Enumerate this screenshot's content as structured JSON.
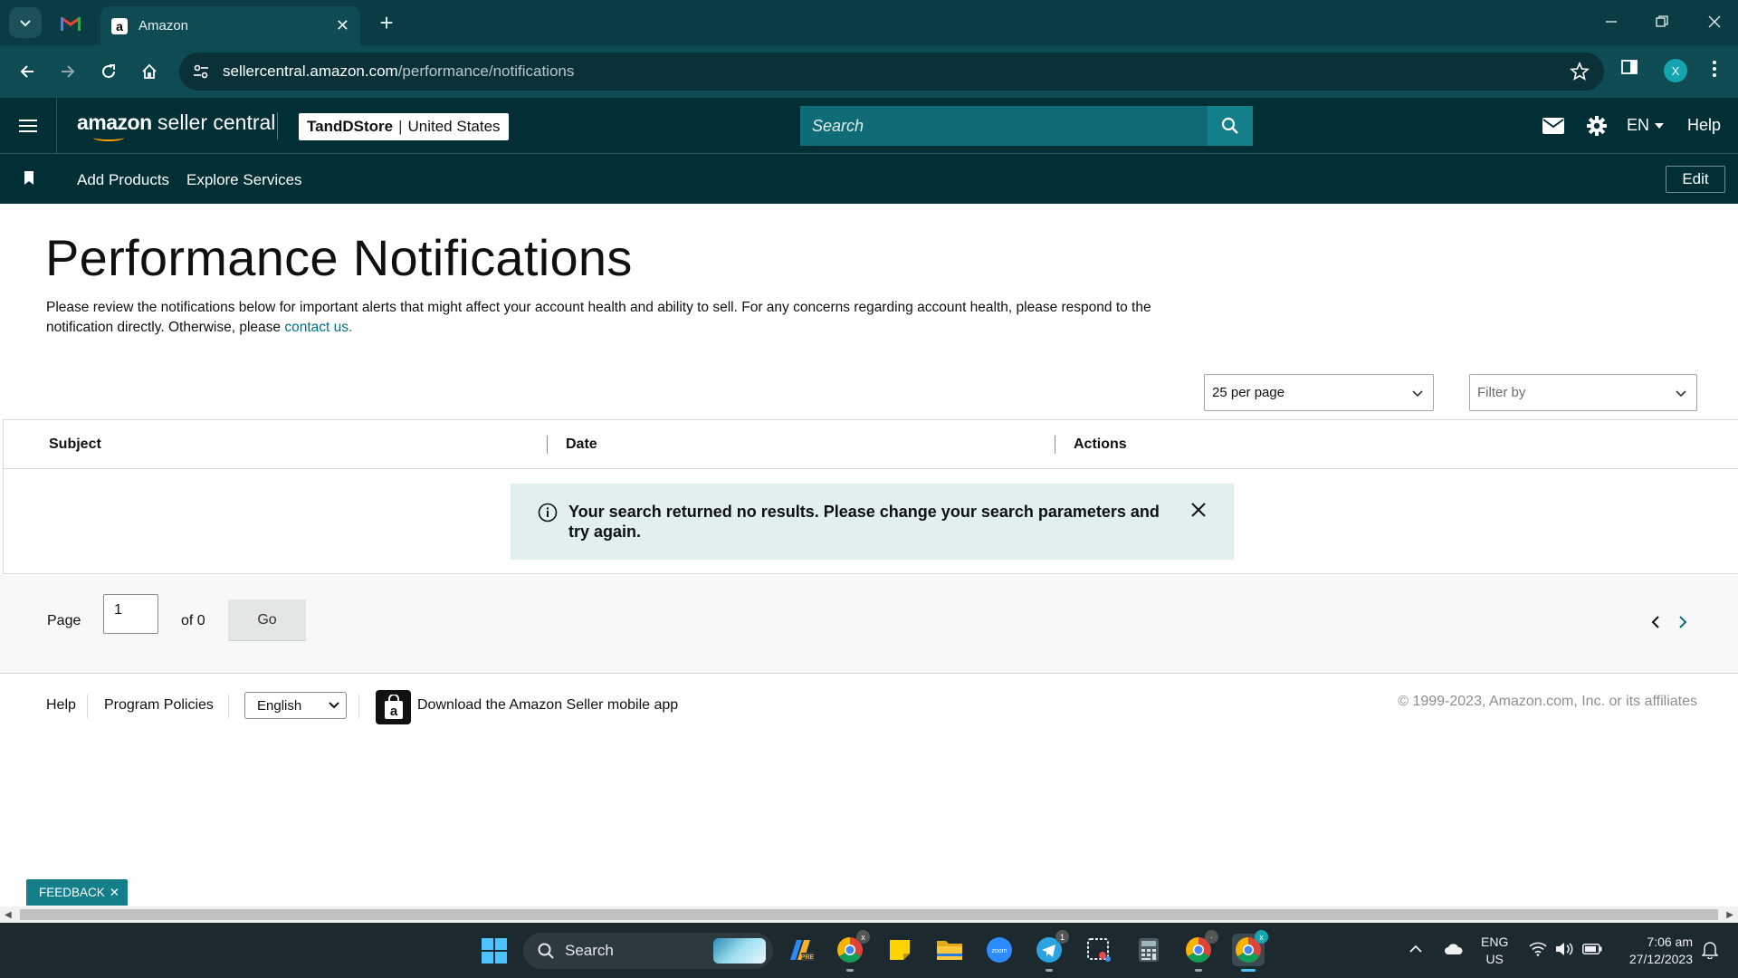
{
  "browser": {
    "tab_title": "Amazon",
    "url_host": "sellercentral.amazon.com",
    "url_path": "/performance/notifications",
    "profile_initial": "X"
  },
  "header": {
    "logo_bold": "amazon",
    "logo_rest": " seller central",
    "store_name": "TandDStore",
    "store_separator": "|",
    "store_region": "United States",
    "search_placeholder": "Search",
    "language": "EN",
    "help": "Help"
  },
  "subnav": {
    "links": [
      "Add Products",
      "Explore Services"
    ],
    "edit_label": "Edit"
  },
  "page": {
    "title": "Performance Notifications",
    "intro_text": "Please review the notifications below for important alerts that might affect your account health and ability to sell. For any concerns regarding account health, please respond to the notification directly. Otherwise, please ",
    "intro_link": "contact us."
  },
  "controls": {
    "per_page": "25 per page",
    "filter_placeholder": "Filter by"
  },
  "table": {
    "columns": [
      "Subject",
      "Date",
      "Actions"
    ],
    "empty_message": "Your search returned no results. Please change your search parameters and try again."
  },
  "pager": {
    "page_label": "Page",
    "page_value": "1",
    "of_label": "of 0",
    "go_label": "Go"
  },
  "footer": {
    "help": "Help",
    "program_policies": "Program Policies",
    "language_select": "English",
    "app_link": "Download the Amazon Seller mobile app",
    "copyright": "© 1999-2023, Amazon.com, Inc. or its affiliates"
  },
  "feedback": {
    "label": "FEEDBACK"
  },
  "taskbar": {
    "search_label": "Search",
    "lang_line1": "ENG",
    "lang_line2": "US",
    "time": "7:06 am",
    "date": "27/12/2023",
    "telegram_badge": "1"
  },
  "colors": {
    "chrome_tabbar": "#0c3c43",
    "chrome_toolbar": "#0e4b52",
    "seller_header": "#002f36",
    "search_teal": "#127f8a",
    "link": "#007185",
    "alert_bg": "#e1eff0",
    "feedback": "#127f8a"
  }
}
